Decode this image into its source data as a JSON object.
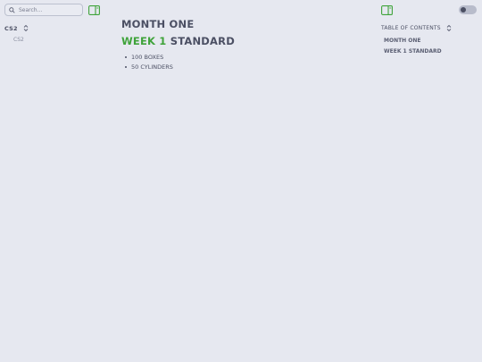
{
  "sidebar": {
    "search": {
      "placeholder": "Search..."
    },
    "tree": {
      "header": "CS2",
      "items": [
        {
          "label": "CS2"
        }
      ]
    }
  },
  "main": {
    "title": "MONTH ONE",
    "subtitle_highlight": "WEEK 1",
    "subtitle_rest": "STANDARD",
    "list": [
      "100 BOXES",
      "50 CYLINDERS"
    ]
  },
  "toc": {
    "header": "TABLE OF CONTENTS",
    "items": [
      {
        "label": "MONTH ONE"
      },
      {
        "label": "WEEK 1 STANDARD"
      }
    ]
  },
  "theme": {
    "toggle_state": "off",
    "accent": "#3fa33a",
    "background": "#e6e8f0"
  }
}
